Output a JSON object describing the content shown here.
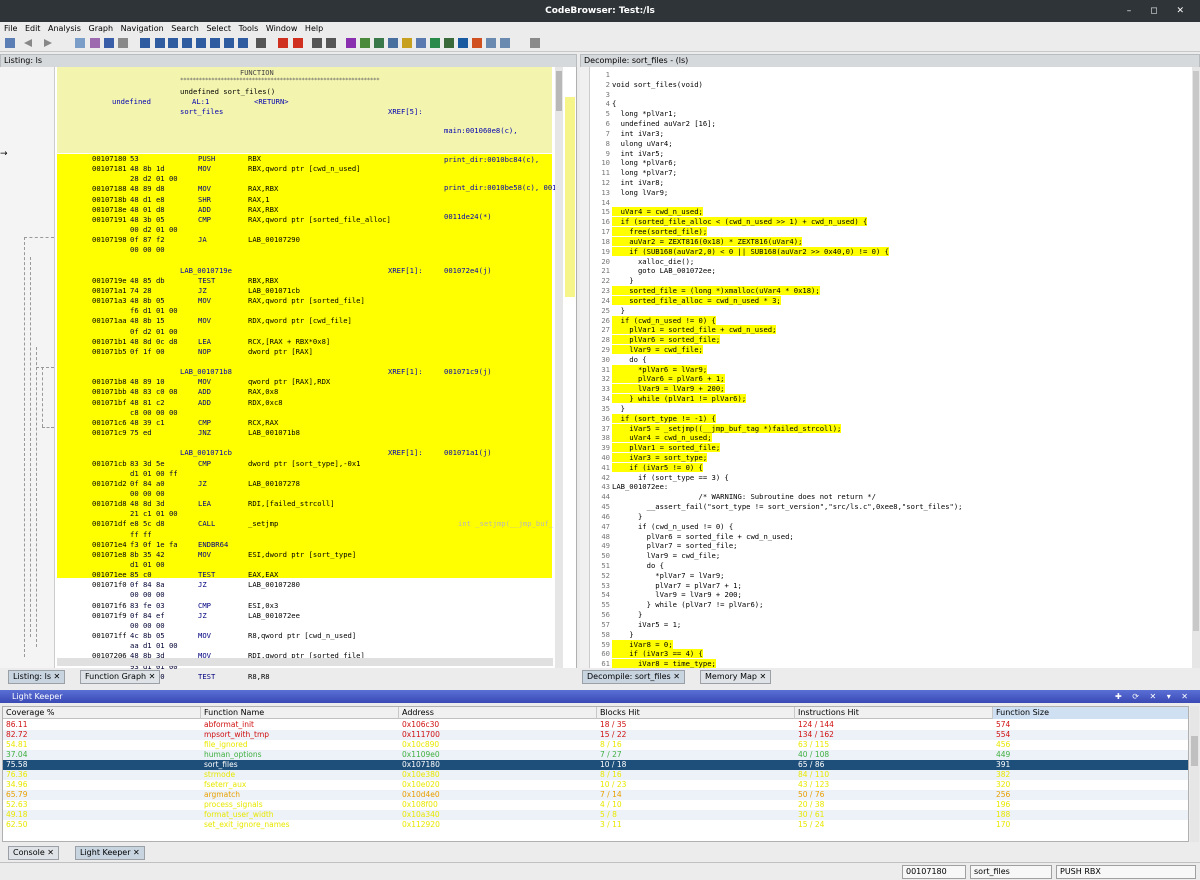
{
  "window": {
    "title": "CodeBrowser: Test:/ls",
    "controls": "– ◻ ✕"
  },
  "menu": [
    "File",
    "Edit",
    "Analysis",
    "Graph",
    "Navigation",
    "Search",
    "Select",
    "Tools",
    "Window",
    "Help"
  ],
  "listing": {
    "header": "Listing:  ls",
    "func_banner": "FUNCTION",
    "sig": "undefined sort_files()",
    "ret_type": "undefined",
    "ret_reg": "AL:1",
    "ret_tag": "<RETURN>",
    "func_name": "sort_files",
    "xref_label": "XREF[5]:",
    "xrefs": [
      "main:001060e8(c),",
      "print_dir:0010bc84(c),",
      "print_dir:0010be58(c), 001",
      "0011de24(*)"
    ],
    "rows": [
      {
        "a": "00107180",
        "b": "53",
        "m": "PUSH",
        "o": "RBX"
      },
      {
        "a": "00107181",
        "b": "48 8b 1d",
        "m": "MOV",
        "o": "RBX,qword ptr [cwd_n_used]"
      },
      {
        "a": "",
        "b": "28 d2 01 00",
        "m": "",
        "o": ""
      },
      {
        "a": "00107188",
        "b": "48 89 d8",
        "m": "MOV",
        "o": "RAX,RBX"
      },
      {
        "a": "0010718b",
        "b": "48 d1 e8",
        "m": "SHR",
        "o": "RAX,1"
      },
      {
        "a": "0010718e",
        "b": "48 01 d8",
        "m": "ADD",
        "o": "RAX,RBX"
      },
      {
        "a": "00107191",
        "b": "48 3b 05",
        "m": "CMP",
        "o": "RAX,qword ptr [sorted_file_alloc]"
      },
      {
        "a": "",
        "b": "00 d2 01 00",
        "m": "",
        "o": ""
      },
      {
        "a": "00107198",
        "b": "0f 87 f2",
        "m": "JA",
        "o": "LAB_00107290"
      },
      {
        "a": "",
        "b": "00 00 00",
        "m": "",
        "o": ""
      },
      {
        "a": "",
        "b": "",
        "m": "",
        "o": ""
      },
      {
        "lbl": "LAB_0010719e",
        "xr": "XREF[1]:",
        "xrv": "001072e4(j)"
      },
      {
        "a": "0010719e",
        "b": "48 85 db",
        "m": "TEST",
        "o": "RBX,RBX"
      },
      {
        "a": "001071a1",
        "b": "74 28",
        "m": "JZ",
        "o": "LAB_001071cb"
      },
      {
        "a": "001071a3",
        "b": "48 8b 05",
        "m": "MOV",
        "o": "RAX,qword ptr [sorted_file]"
      },
      {
        "a": "",
        "b": "f6 d1 01 00",
        "m": "",
        "o": ""
      },
      {
        "a": "001071aa",
        "b": "48 8b 15",
        "m": "MOV",
        "o": "RDX,qword ptr [cwd_file]"
      },
      {
        "a": "",
        "b": "0f d2 01 00",
        "m": "",
        "o": ""
      },
      {
        "a": "001071b1",
        "b": "48 8d 0c d8",
        "m": "LEA",
        "o": "RCX,[RAX + RBX*0x8]"
      },
      {
        "a": "001071b5",
        "b": "0f 1f 00",
        "m": "NOP",
        "o": "dword ptr [RAX]"
      },
      {
        "a": "",
        "b": "",
        "m": "",
        "o": ""
      },
      {
        "lbl": "LAB_001071b8",
        "xr": "XREF[1]:",
        "xrv": "001071c9(j)"
      },
      {
        "a": "001071b8",
        "b": "48 89 10",
        "m": "MOV",
        "o": "qword ptr [RAX],RDX"
      },
      {
        "a": "001071bb",
        "b": "48 83 c0 08",
        "m": "ADD",
        "o": "RAX,0x8"
      },
      {
        "a": "001071bf",
        "b": "48 81 c2",
        "m": "ADD",
        "o": "RDX,0xc8"
      },
      {
        "a": "",
        "b": "c8 00 00 00",
        "m": "",
        "o": ""
      },
      {
        "a": "001071c6",
        "b": "48 39 c1",
        "m": "CMP",
        "o": "RCX,RAX"
      },
      {
        "a": "001071c9",
        "b": "75 ed",
        "m": "JNZ",
        "o": "LAB_001071b8"
      },
      {
        "a": "",
        "b": "",
        "m": "",
        "o": ""
      },
      {
        "lbl": "LAB_001071cb",
        "xr": "XREF[1]:",
        "xrv": "001071a1(j)"
      },
      {
        "a": "001071cb",
        "b": "83 3d 5e",
        "m": "CMP",
        "o": "dword ptr [sort_type],-0x1"
      },
      {
        "a": "",
        "b": "d1 01 00 ff",
        "m": "",
        "o": ""
      },
      {
        "a": "001071d2",
        "b": "0f 84 a0",
        "m": "JZ",
        "o": "LAB_00107278"
      },
      {
        "a": "",
        "b": "00 00 00",
        "m": "",
        "o": ""
      },
      {
        "a": "001071d8",
        "b": "48 8d 3d",
        "m": "LEA",
        "o": "RDI,[failed_strcoll]"
      },
      {
        "a": "",
        "b": "21 c1 01 00",
        "m": "",
        "o": ""
      },
      {
        "a": "001071df",
        "b": "e8 5c d8",
        "m": "CALL",
        "o": "_setjmp",
        "x": "int _setjmp(__jmp_buf_"
      },
      {
        "a": "",
        "b": "ff ff",
        "m": "",
        "o": ""
      },
      {
        "a": "001071e4",
        "b": "f3 0f 1e fa",
        "m": "ENDBR64",
        "o": ""
      },
      {
        "a": "001071e8",
        "b": "8b 35 42",
        "m": "MOV",
        "o": "ESI,dword ptr [sort_type]"
      },
      {
        "a": "",
        "b": "d1 01 00",
        "m": "",
        "o": ""
      },
      {
        "a": "001071ee",
        "b": "85 c0",
        "m": "TEST",
        "o": "EAX,EAX"
      },
      {
        "a": "001071f0",
        "b": "0f 84 8a",
        "m": "JZ",
        "o": "LAB_00107280"
      },
      {
        "a": "",
        "b": "00 00 00",
        "m": "",
        "o": ""
      },
      {
        "a": "001071f6",
        "b": "83 fe 03",
        "m": "CMP",
        "o": "ESI,0x3"
      },
      {
        "a": "001071f9",
        "b": "0f 84 ef",
        "m": "JZ",
        "o": "LAB_001072ee"
      },
      {
        "a": "",
        "b": "00 00 00",
        "m": "",
        "o": ""
      },
      {
        "a": "001071ff",
        "b": "4c 8b 05",
        "m": "MOV",
        "o": "R8,qword ptr [cwd_n_used]"
      },
      {
        "a": "",
        "b": "aa d1 01 00",
        "m": "",
        "o": ""
      },
      {
        "a": "00107206",
        "b": "48 8b 3d",
        "m": "MOV",
        "o": "RDI,qword ptr [sorted_file]"
      },
      {
        "a": "",
        "b": "93 d1 01 00",
        "m": "",
        "o": ""
      },
      {
        "a": "0010720d",
        "b": "4d 85 c0",
        "m": "TEST",
        "o": "R8,R8"
      }
    ]
  },
  "decompile": {
    "header": "Decompile: sort_files -  (ls)",
    "lines": [
      {
        "n": "1",
        "t": ""
      },
      {
        "n": "2",
        "t": "void sort_files(void)"
      },
      {
        "n": "3",
        "t": ""
      },
      {
        "n": "4",
        "t": "{"
      },
      {
        "n": "5",
        "t": "  long *plVar1;"
      },
      {
        "n": "6",
        "t": "  undefined auVar2 [16];"
      },
      {
        "n": "7",
        "t": "  int iVar3;"
      },
      {
        "n": "8",
        "t": "  ulong uVar4;"
      },
      {
        "n": "9",
        "t": "  int iVar5;"
      },
      {
        "n": "10",
        "t": "  long *plVar6;"
      },
      {
        "n": "11",
        "t": "  long *plVar7;"
      },
      {
        "n": "12",
        "t": "  int iVar8;"
      },
      {
        "n": "13",
        "t": "  long lVar9;"
      },
      {
        "n": "14",
        "t": ""
      },
      {
        "n": "15",
        "t": "  uVar4 = cwd_n_used;",
        "h": 1
      },
      {
        "n": "16",
        "t": "  if (sorted_file_alloc < (cwd_n_used >> 1) + cwd_n_used) {",
        "h": 1
      },
      {
        "n": "17",
        "t": "    free(sorted_file);",
        "h": 1
      },
      {
        "n": "18",
        "t": "    auVar2 = ZEXT816(0x18) * ZEXT816(uVar4);",
        "h": 1
      },
      {
        "n": "19",
        "t": "    if (SUB168(auVar2,0) < 0 || SUB168(auVar2 >> 0x40,0) != 0) {",
        "h": 1
      },
      {
        "n": "20",
        "t": "      xalloc_die();"
      },
      {
        "n": "21",
        "t": "      goto LAB_001072ee;"
      },
      {
        "n": "22",
        "t": "    }"
      },
      {
        "n": "23",
        "t": "    sorted_file = (long *)xmalloc(uVar4 * 0x18);",
        "h": 1
      },
      {
        "n": "24",
        "t": "    sorted_file_alloc = cwd_n_used * 3;",
        "h": 1
      },
      {
        "n": "25",
        "t": "  }"
      },
      {
        "n": "26",
        "t": "  if (cwd_n_used != 0) {",
        "h": 1
      },
      {
        "n": "27",
        "t": "    plVar1 = sorted_file + cwd_n_used;",
        "h": 1
      },
      {
        "n": "28",
        "t": "    plVar6 = sorted_file;",
        "h": 1
      },
      {
        "n": "29",
        "t": "    lVar9 = cwd_file;",
        "h": 1
      },
      {
        "n": "30",
        "t": "    do {"
      },
      {
        "n": "31",
        "t": "      *plVar6 = lVar9;",
        "h": 1
      },
      {
        "n": "32",
        "t": "      plVar6 = plVar6 + 1;",
        "h": 1
      },
      {
        "n": "33",
        "t": "      lVar9 = lVar9 + 200;",
        "h": 1
      },
      {
        "n": "34",
        "t": "    } while (plVar1 != plVar6);",
        "h": 1
      },
      {
        "n": "35",
        "t": "  }"
      },
      {
        "n": "36",
        "t": "  if (sort_type != -1) {",
        "h": 1
      },
      {
        "n": "37",
        "t": "    iVar5 = _setjmp((__jmp_buf_tag *)failed_strcoll);",
        "h": 1
      },
      {
        "n": "38",
        "t": "    uVar4 = cwd_n_used;",
        "h": 1
      },
      {
        "n": "39",
        "t": "    plVar1 = sorted_file;",
        "h": 1
      },
      {
        "n": "40",
        "t": "    iVar3 = sort_type;",
        "h": 1
      },
      {
        "n": "41",
        "t": "    if (iVar5 != 0) {",
        "h": 1
      },
      {
        "n": "42",
        "t": "      if (sort_type == 3) {"
      },
      {
        "n": "43",
        "t": "LAB_001072ee:"
      },
      {
        "n": "44",
        "t": "                    /* WARNING: Subroutine does not return */"
      },
      {
        "n": "45",
        "t": "        __assert_fail(\"sort_type != sort_version\",\"src/ls.c\",0xee8,\"sort_files\");"
      },
      {
        "n": "46",
        "t": "      }"
      },
      {
        "n": "47",
        "t": "      if (cwd_n_used != 0) {"
      },
      {
        "n": "48",
        "t": "        plVar6 = sorted_file + cwd_n_used;"
      },
      {
        "n": "49",
        "t": "        plVar7 = sorted_file;"
      },
      {
        "n": "50",
        "t": "        lVar9 = cwd_file;"
      },
      {
        "n": "51",
        "t": "        do {"
      },
      {
        "n": "52",
        "t": "          *plVar7 = lVar9;"
      },
      {
        "n": "53",
        "t": "          plVar7 = plVar7 + 1;"
      },
      {
        "n": "54",
        "t": "          lVar9 = lVar9 + 200;"
      },
      {
        "n": "55",
        "t": "        } while (plVar7 != plVar6);"
      },
      {
        "n": "56",
        "t": "      }"
      },
      {
        "n": "57",
        "t": "      iVar5 = 1;"
      },
      {
        "n": "58",
        "t": "    }"
      },
      {
        "n": "59",
        "t": "    iVar8 = 0;",
        "h": 1
      },
      {
        "n": "60",
        "t": "    if (iVar3 == 4) {",
        "h": 1
      },
      {
        "n": "61",
        "t": "      iVar8 = time_type;",
        "h": 1
      }
    ]
  },
  "tabs_left": [
    "Listing:  ls",
    "Function Graph"
  ],
  "tabs_right": [
    "Decompile: sort_files",
    "Memory Map"
  ],
  "lightkeeper": {
    "title": "Light Keeper",
    "columns": [
      "Coverage %",
      "Function Name",
      "Address",
      "Blocks Hit",
      "Instructions Hit",
      "Function Size"
    ],
    "rows": [
      {
        "c": "86.11",
        "f": "abformat_init",
        "a": "0x106c30",
        "b": "18 / 35",
        "i": "124 / 144",
        "s": "574",
        "color": "#d01010"
      },
      {
        "c": "82.72",
        "f": "mpsort_with_tmp",
        "a": "0x111700",
        "b": "15 / 22",
        "i": "134 / 162",
        "s": "554",
        "color": "#d01010"
      },
      {
        "c": "54.81",
        "f": "file_ignored",
        "a": "0x10c890",
        "b": "8 / 16",
        "i": "63 / 115",
        "s": "456",
        "color": "#e8e800"
      },
      {
        "c": "37.04",
        "f": "human_options",
        "a": "0x1109e0",
        "b": "7 / 27",
        "i": "40 / 108",
        "s": "449",
        "color": "#40b040"
      },
      {
        "c": "75.58",
        "f": "sort_files",
        "a": "0x107180",
        "b": "10 / 18",
        "i": "65 / 86",
        "s": "391",
        "color": "#fff",
        "sel": 1
      },
      {
        "c": "76.36",
        "f": "strmode",
        "a": "0x10e380",
        "b": "8 / 16",
        "i": "84 / 110",
        "s": "382",
        "color": "#e8e800"
      },
      {
        "c": "34.96",
        "f": "fseterr_aux",
        "a": "0x10e020",
        "b": "10 / 23",
        "i": "43 / 123",
        "s": "320",
        "color": "#e8e800"
      },
      {
        "c": "65.79",
        "f": "argmatch",
        "a": "0x10d4e0",
        "b": "7 / 14",
        "i": "50 / 76",
        "s": "256",
        "color": "#e8a000"
      },
      {
        "c": "52.63",
        "f": "process_signals",
        "a": "0x108f00",
        "b": "4 / 10",
        "i": "20 / 38",
        "s": "196",
        "color": "#e8e800"
      },
      {
        "c": "49.18",
        "f": "format_user_width",
        "a": "0x10a340",
        "b": "5 / 8",
        "i": "30 / 61",
        "s": "188",
        "color": "#e8e800"
      },
      {
        "c": "62.50",
        "f": "set_exit_ignore_names",
        "a": "0x112920",
        "b": "3 / 11",
        "i": "15 / 24",
        "s": "170",
        "color": "#e8e800"
      }
    ]
  },
  "bottom_tabs": [
    "Console",
    "Light Keeper"
  ],
  "status": {
    "addr": "00107180",
    "func": "sort_files",
    "instr": "PUSH RBX"
  }
}
